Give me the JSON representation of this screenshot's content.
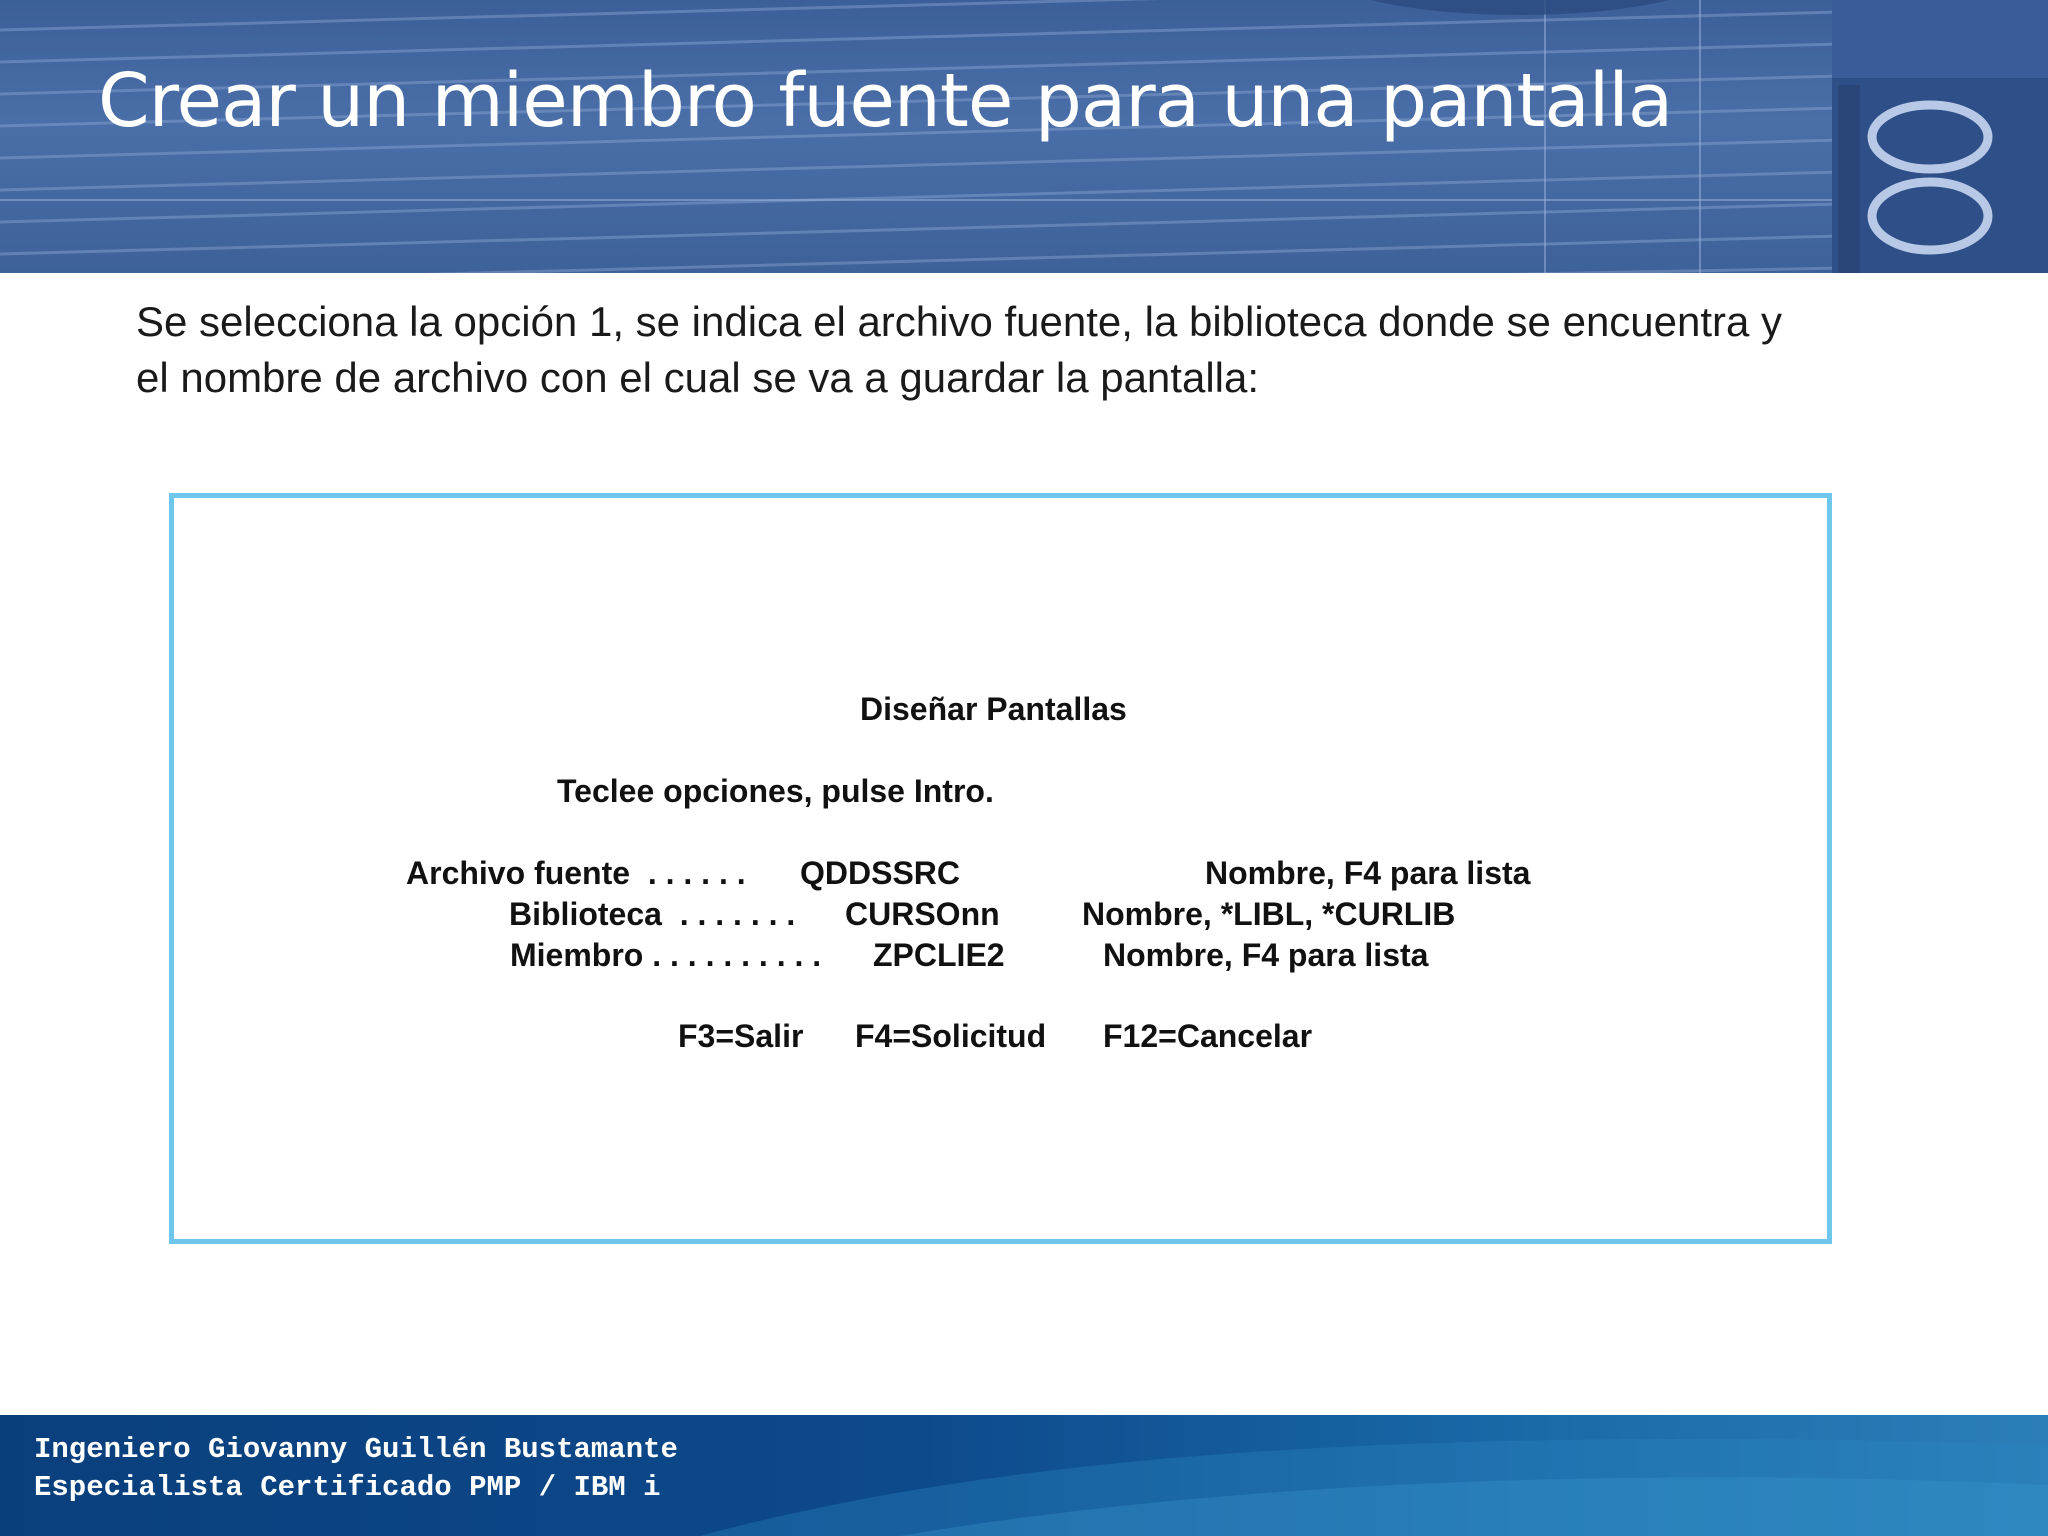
{
  "slide": {
    "title": "Crear un miembro fuente para una pantalla",
    "intro_line1": "Se selecciona la opción 1, se indica el archivo fuente, la biblioteca donde se encuentra y",
    "intro_line2": "el nombre de archivo  con el cual se va a guardar la pantalla:"
  },
  "screen": {
    "heading": "Diseñar Pantallas",
    "instruction": "Teclee opciones, pulse Intro.",
    "fields": [
      {
        "label": "Archivo fuente  . . . . . .",
        "value": "QDDSSRC",
        "hint": "Nombre, F4 para lista"
      },
      {
        "label": "Biblioteca  . . . . . . .",
        "value": "CURSOnn",
        "hint": "Nombre, *LIBL, *CURLIB"
      },
      {
        "label": "Miembro . . . . . . . . . .",
        "value": "ZPCLIE2",
        "hint": "Nombre, F4 para lista"
      }
    ],
    "fkeys": [
      "F3=Salir",
      "F4=Solicitud",
      "F12=Cancelar"
    ]
  },
  "footer": {
    "line1": "Ingeniero Giovanny Guillén Bustamante",
    "line2": "Especialista Certificado PMP / IBM i"
  },
  "colors": {
    "header_blue": "#4a6ea8",
    "box_border": "#6fc6ec",
    "footer_blue": "#0d4a8c"
  }
}
